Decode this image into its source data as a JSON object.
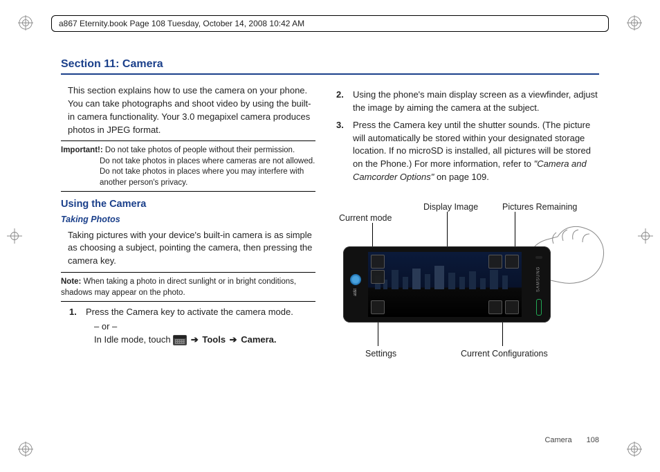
{
  "page_header": "a867 Eternity.book  Page 108  Tuesday, October 14, 2008  10:42 AM",
  "section_title": "Section 11: Camera",
  "intro": "This section explains how to use the camera on your phone. You can take photographs and shoot video by using the built-in camera functionality. Your 3.0 megapixel camera produces photos in JPEG format.",
  "important_label": "Important!:",
  "important_lines": [
    "Do not take photos of people without their permission.",
    "Do not take photos in places where cameras are not allowed.",
    "Do not take photos in places where you may interfere with another person's privacy."
  ],
  "h2_using": "Using the Camera",
  "h3_taking": "Taking Photos",
  "taking_body": "Taking pictures with your device's built-in camera is as simple as choosing a subject, pointing the camera, then pressing the camera key.",
  "note_label": "Note:",
  "note_body": "When taking a photo in direct sunlight or in bright conditions, shadows may appear on the photo.",
  "steps": {
    "s1": "Press the Camera key to activate the camera mode.",
    "s1_or": "– or –",
    "s1_b_pre": "In Idle mode, touch ",
    "s1_b_post_tools": "Tools",
    "s1_b_post_camera": "Camera.",
    "s2": "Using the phone's main display screen as a viewfinder, adjust the image by aiming the camera at the subject.",
    "s3_a": "Press the Camera key until the shutter sounds. (The picture will automatically be stored within your designated storage location. If no microSD is installed, all pictures will be stored on the Phone.) For more information, refer to ",
    "s3_ref": "\"Camera and Camcorder Options\"",
    "s3_b": "  on page 109."
  },
  "diagram_labels": {
    "current_mode": "Current mode",
    "display_image": "Display Image",
    "pictures_remaining": "Pictures Remaining",
    "settings": "Settings",
    "current_config": "Current Configurations"
  },
  "brand_att": "at&t",
  "brand_samsung": "SAMSUNG",
  "footer_label": "Camera",
  "footer_page": "108"
}
